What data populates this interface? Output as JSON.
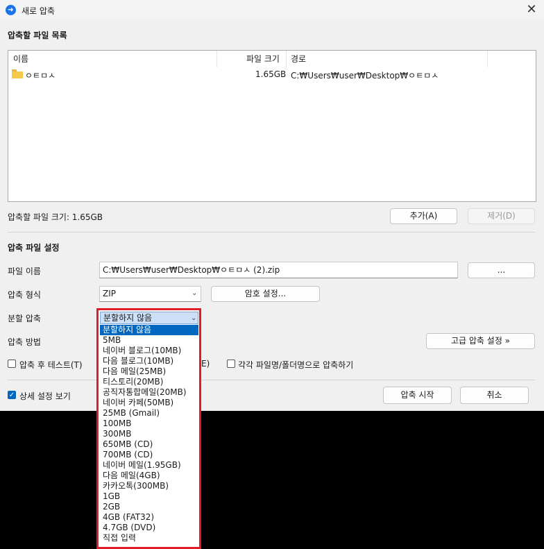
{
  "window": {
    "title": "새로 압축",
    "close_glyph": "✕",
    "app_icon_glyph": "➜"
  },
  "file_list": {
    "section_title": "압축할 파일 목록",
    "columns": [
      "이름",
      "파일 크기",
      "경로"
    ],
    "rows": [
      {
        "name": "ㅇㅌㅁㅅ",
        "size": "1.65GB",
        "path": "C:₩Users₩user₩Desktop₩ㅇㅌㅁㅅ"
      }
    ],
    "total_size_label": "압축할 파일 크기: 1.65GB",
    "add_button": "추가(A)",
    "remove_button": "제거(D)"
  },
  "settings": {
    "section_title": "압축 파일 설정",
    "filename_label": "파일 이름",
    "filename_value": "C:₩Users₩user₩Desktop₩ㅇㅌㅁㅅ (2).zip",
    "browse_button": "...",
    "format_label": "압축 형식",
    "format_value": "ZIP",
    "password_button": "암호 설정...",
    "split_label": "분할 압축",
    "method_label": "압축 방법",
    "advanced_button": "고급 압축 설정 »",
    "test_checkbox_label": "압축 후 테스트(T)",
    "test_checked": false,
    "partial_label_tail": "E)",
    "each_checkbox_label": "각각 파일명/폴더명으로 압축하기",
    "each_checked": false
  },
  "footer": {
    "details_label": "상세 설정 보기",
    "details_checked": true,
    "start_button": "압축 시작",
    "cancel_button": "취소"
  },
  "split_dropdown": {
    "selected": "분할하지 않음",
    "options": [
      "분할하지 않음",
      "5MB",
      "네이버 블로그(10MB)",
      "다음 블로그(10MB)",
      "다음 메일(25MB)",
      "티스토리(20MB)",
      "공직자통합메일(20MB)",
      "네이버 카페(50MB)",
      "25MB (Gmail)",
      "100MB",
      "300MB",
      "650MB (CD)",
      "700MB (CD)",
      "네이버 메일(1.95GB)",
      "다음 메일(4GB)",
      "카카오톡(300MB)",
      "1GB",
      "2GB",
      "4GB (FAT32)",
      "4.7GB (DVD)",
      "직접 입력"
    ],
    "highlight_color": "#e01e2b",
    "selection_color": "#0067c0"
  }
}
